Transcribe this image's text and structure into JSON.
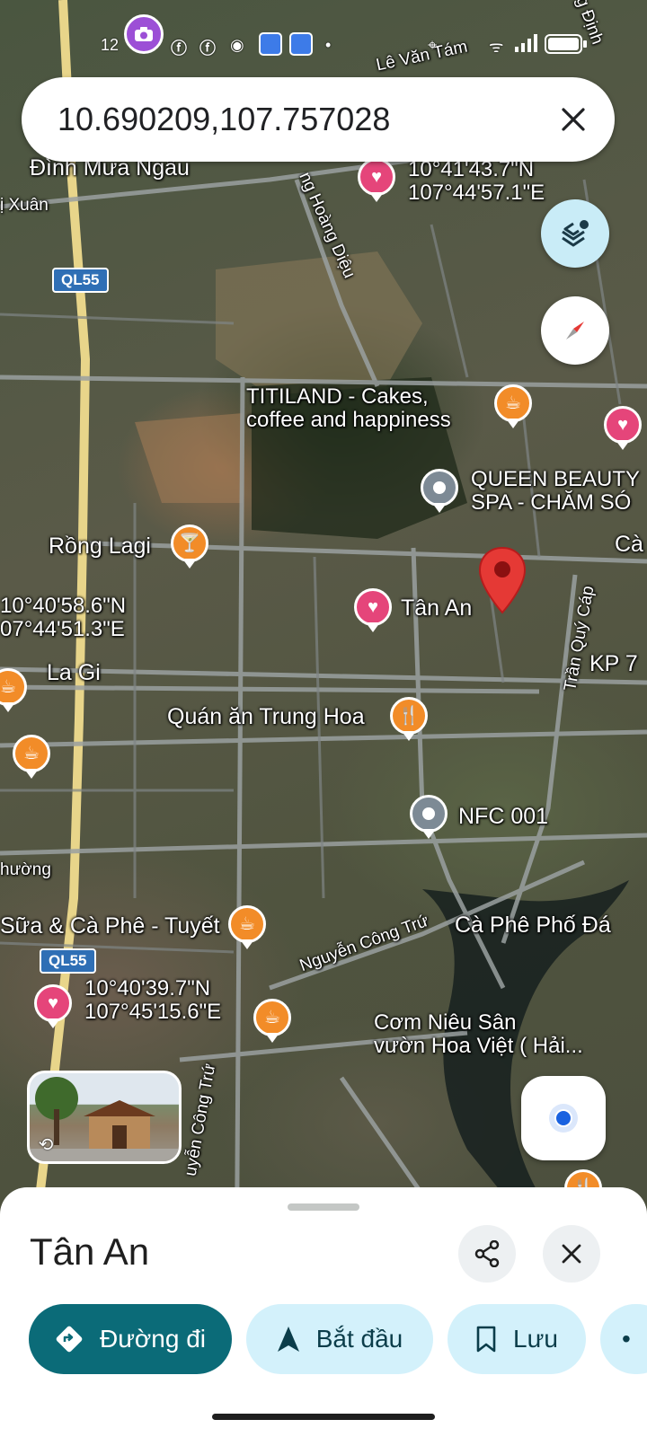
{
  "status_bar": {
    "time": "12",
    "indicators": [
      "camera-app-icon",
      "facebook-icon",
      "facebook-icon",
      "app-icon",
      "shield-icon",
      "shield-icon",
      "dot",
      "location-icon",
      "wifi-icon",
      "signal-icon",
      "battery-icon"
    ]
  },
  "search": {
    "query": "10.690209,107.757028"
  },
  "map": {
    "labels": {
      "le_van_tam": "Lê Văn Tám",
      "dinh_mua_ngau": "Đình Mưa Ngâu",
      "xuan": "ị Xuân",
      "coord1": "10°41'43.7\"N\n107°44'57.1\"E",
      "hoang_dieu": "ng Hoàng Diệu",
      "ql55_top": "QL55",
      "titiland": "TITILAND - Cakes,\ncoffee and happiness",
      "queen_beauty": "QUEEN BEAUTY\nSPA - CHĂM SÓ",
      "ca_right": "Cà",
      "rong_lagi": "Rồng Lagi",
      "coord2": "10°40'58.6\"N\n07°44'51.3\"E",
      "tan_an": "Tân An",
      "tran_quy_cap": "Trần Quý Cáp",
      "kp": "KP 7",
      "la_gi": "La Gi",
      "quan_an": "Quán ăn Trung Hoa",
      "nfc": "NFC 001",
      "phuong": "hường",
      "sua_ca_phe": "Sữa & Cà Phê - Tuyết",
      "nguyen_cong_tru": "Nguyễn Công Trứ",
      "ca_phe_pho_da": "Cà Phê Phố Đá",
      "ql55_bottom": "QL55",
      "coord3": "10°40'39.7\"N\n107°45'15.6\"E",
      "com_nieu": "Cơm Niêu Sân\nvườn Hoa Việt ( Hải...",
      "nguyen_cong_tru_2": "uyễn Công Trứ",
      "dinh_corner": "g Định"
    }
  },
  "colors": {
    "accent_teal": "#0b6b78",
    "chip_bg": "#d3f1fb",
    "marker_red": "#e53935"
  },
  "sheet": {
    "title": "Tân An",
    "buttons": {
      "directions": "Đường đi",
      "start": "Bắt đầu",
      "save": "Lưu"
    }
  }
}
